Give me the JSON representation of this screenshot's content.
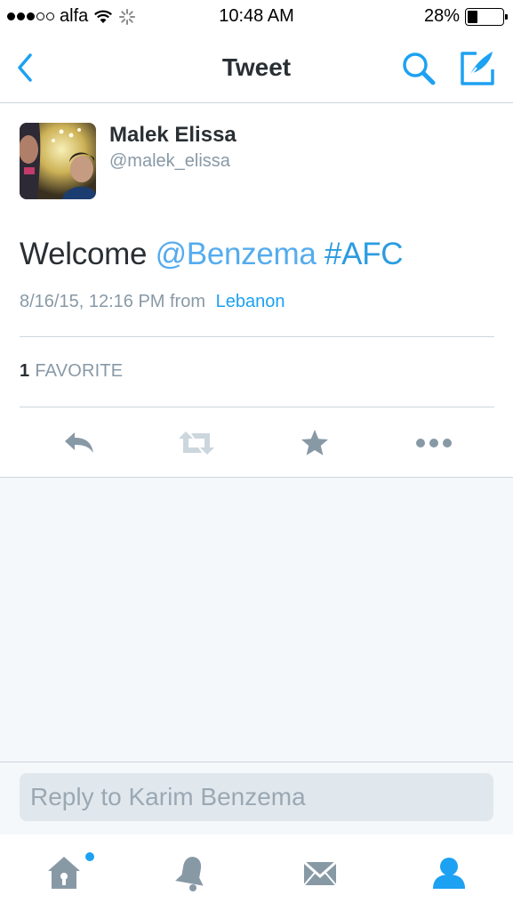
{
  "status_bar": {
    "carrier": "alfa",
    "time": "10:48 AM",
    "battery_percent_label": "28%",
    "battery_level": 0.28
  },
  "nav": {
    "title": "Tweet",
    "back_icon": "chevron-left-icon",
    "search_icon": "search-icon",
    "compose_icon": "compose-icon"
  },
  "tweet": {
    "author_name": "Malek Elissa",
    "author_handle": "@malek_elissa",
    "text_plain": "Welcome",
    "mention": "@Benzema",
    "hashtag": "#AFC",
    "timestamp": "8/16/15, 12:16 PM from",
    "source": "Lebanon",
    "favorite_count": "1",
    "favorite_label": "FAVORITE"
  },
  "reply": {
    "placeholder": "Reply to Karim Benzema"
  },
  "colors": {
    "accent": "#1da1f2",
    "text": "#292f33",
    "muted": "#8899a6",
    "icon_gray": "#8899a6",
    "divider": "#ccd6dd",
    "background": "#f5f8fa"
  }
}
